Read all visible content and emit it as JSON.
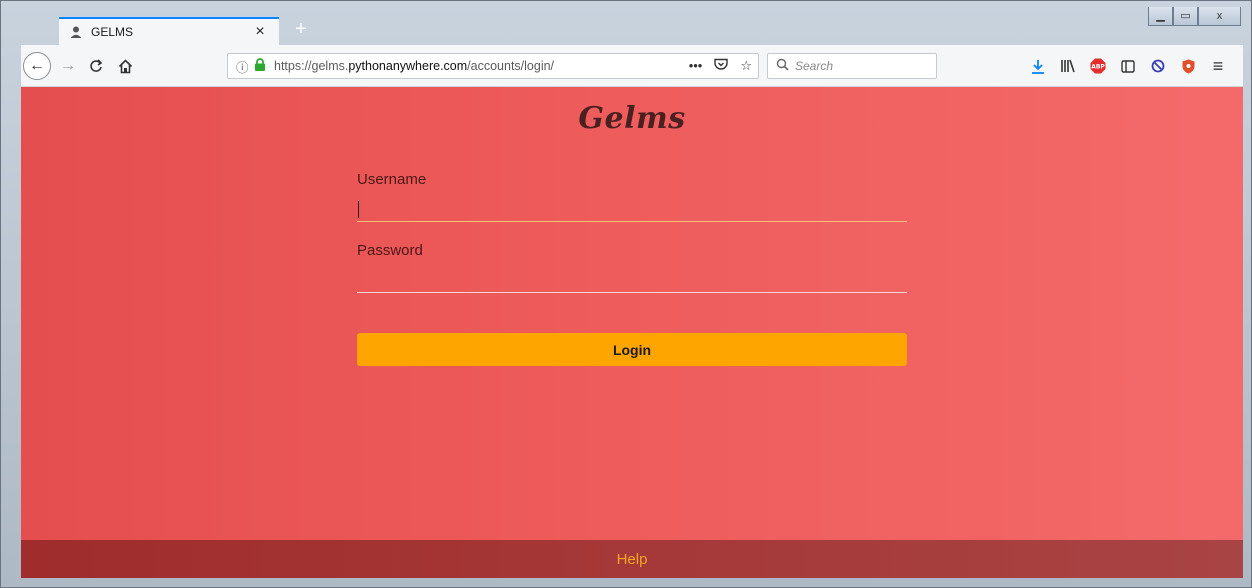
{
  "browser": {
    "tab": {
      "title": "GELMS",
      "close_glyph": "×"
    },
    "new_tab_glyph": "+",
    "window_controls": {
      "minimize": "▁",
      "maximize": "▭",
      "close": "x"
    },
    "url": {
      "prefix": "https://gelms.",
      "host": "pythonanywhere.com",
      "path": "/accounts/login/"
    },
    "search_placeholder": "Search",
    "icons": {
      "back": "←",
      "forward": "→",
      "reload": "C",
      "home": "⌂",
      "info": "ⓘ",
      "lock": "🔒",
      "more": "•••",
      "pocket": "♡",
      "bookmark": "☆",
      "magnifier": "⚲",
      "download": "⤓",
      "library": "|||\\",
      "abp": "ABP",
      "sidebar": "▯",
      "block": "⊘",
      "shield": "◆",
      "menu": "≡"
    },
    "colors": {
      "accent": "#0a84ff",
      "download": "#0a84ff",
      "abp": "#e42d2d",
      "shield": "#e0502a",
      "block": "#3a3fb8"
    }
  },
  "page": {
    "brand": "Gelms",
    "username_label": "Username",
    "password_label": "Password",
    "login_label": "Login",
    "help_link": "Help",
    "colors": {
      "bg_start": "#e54e4e",
      "bg_end": "#f46a6a",
      "button": "#ffa500",
      "footer": "#a53838",
      "help": "#f5a623"
    }
  }
}
